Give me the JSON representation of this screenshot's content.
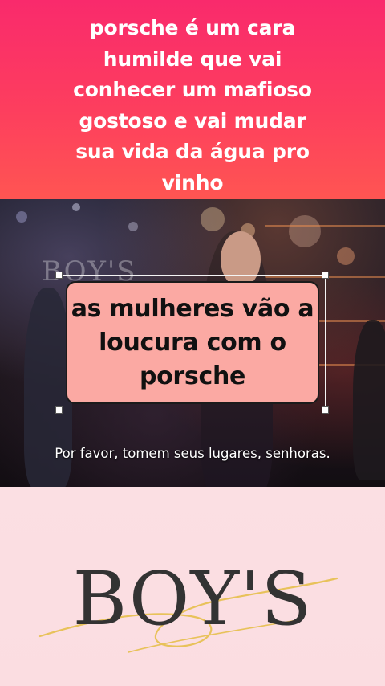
{
  "top_caption": {
    "line1": "porsche é um cara",
    "line2": "humilde que vai",
    "line3": "conhecer um mafioso",
    "line4": "gostoso e vai mudar",
    "line5": "sua vida da água pro",
    "line6": "vinho"
  },
  "video": {
    "watermark": "BOY'S",
    "subtitle": "Por favor, tomem seus lugares, senhoras."
  },
  "sticker": {
    "line1": "as mulheres vão a",
    "line2": "loucura com o",
    "line3": "porsche"
  },
  "logo": {
    "text": "BOY'S",
    "swoosh_color": "#e8c25a"
  },
  "colors": {
    "banner_top": "#f92a6c",
    "banner_bottom": "#ff5552",
    "sticker_fill": "#fba9a3",
    "bottom_panel": "#fbdfe3"
  }
}
